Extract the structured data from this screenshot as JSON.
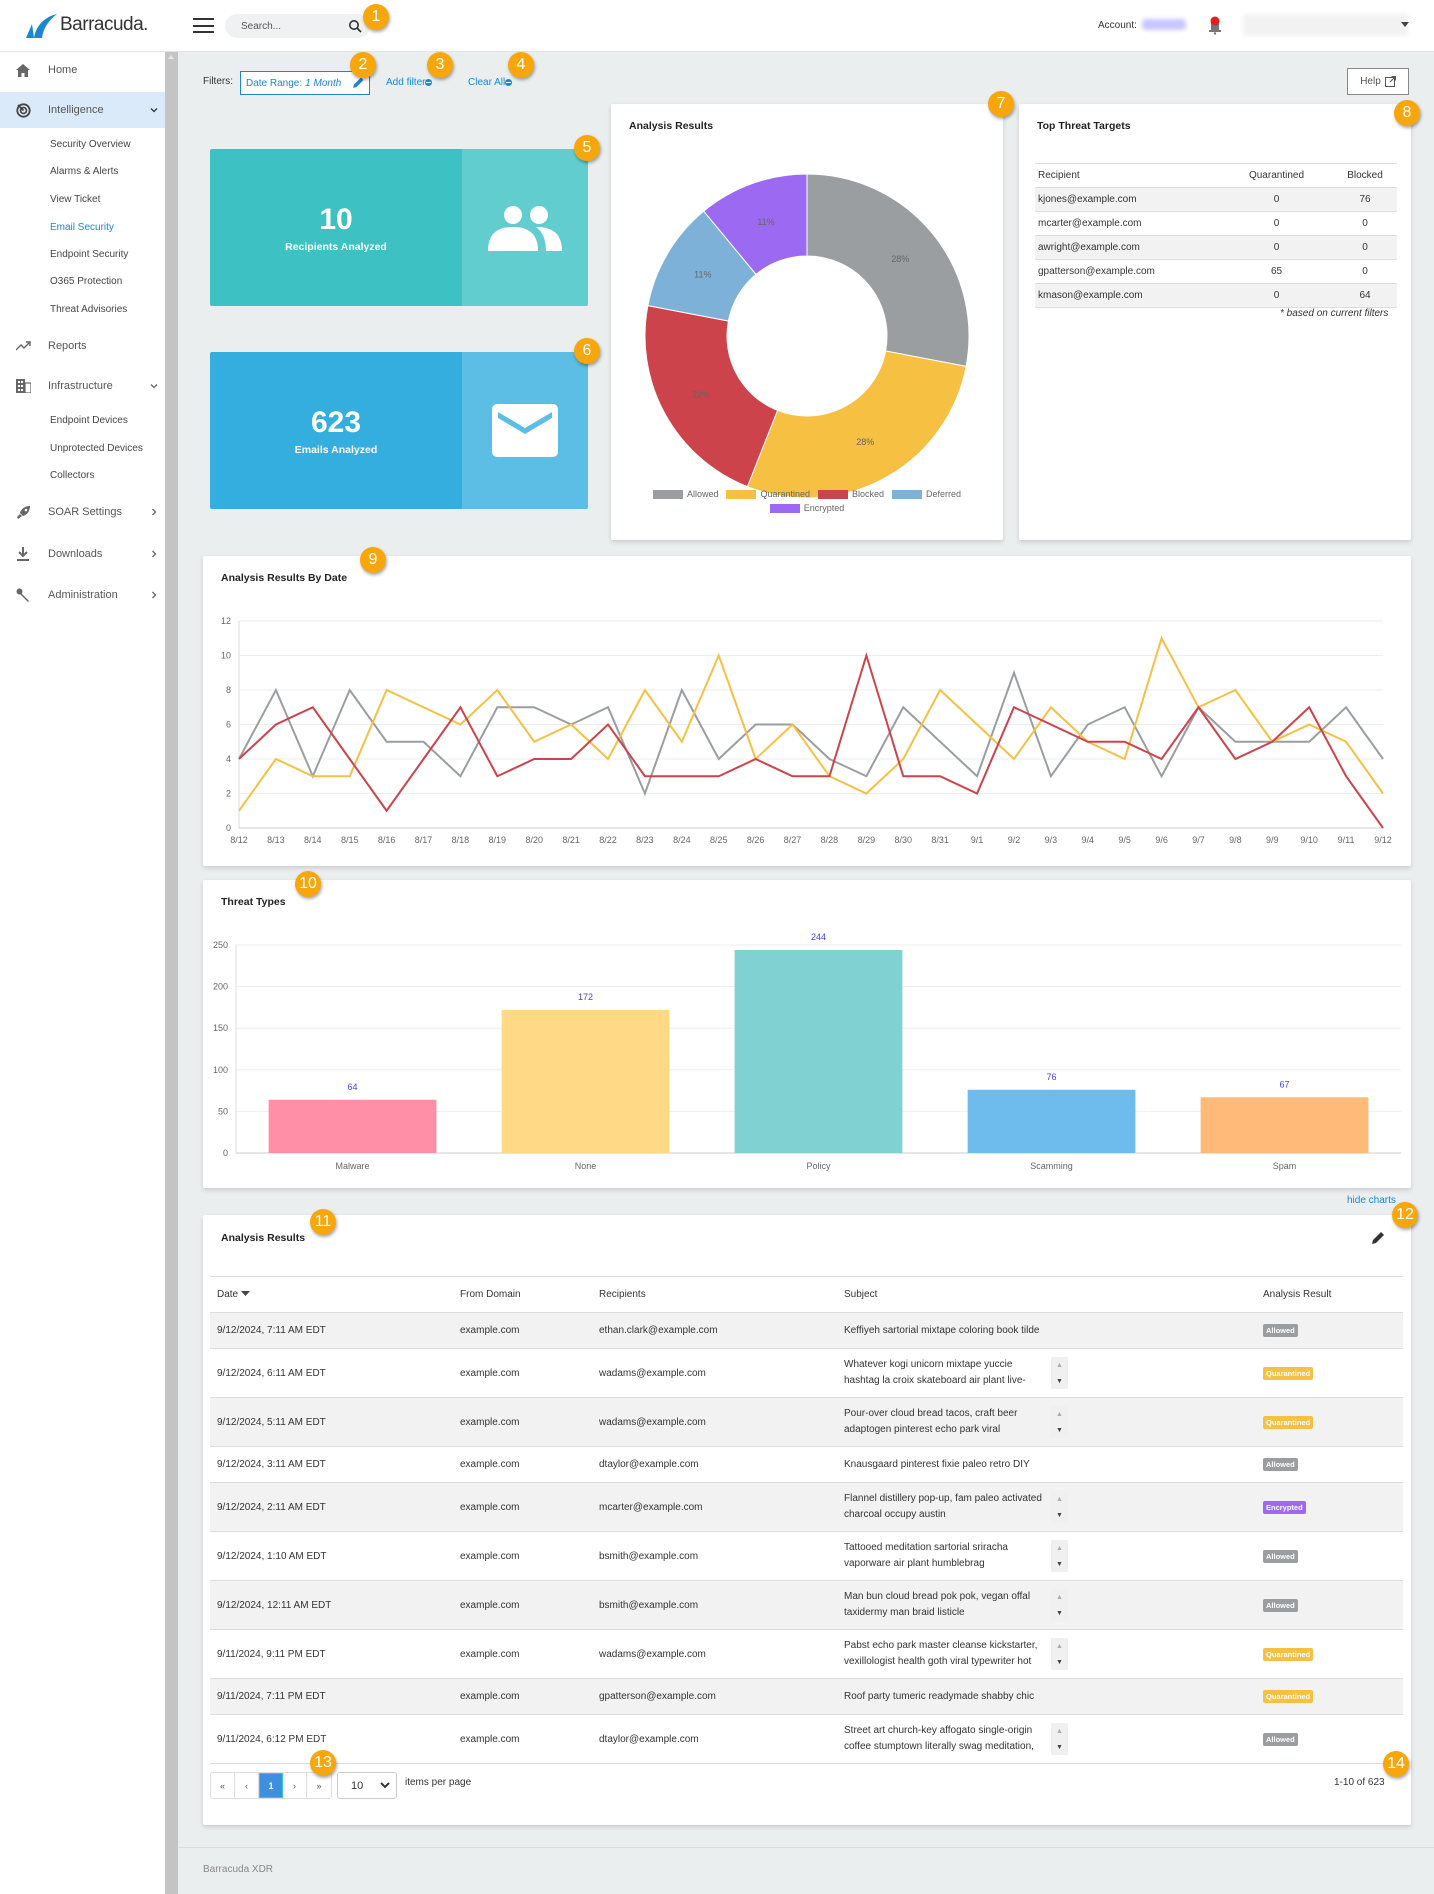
{
  "header": {
    "brand": "Barracuda.",
    "search_placeholder": "Search...",
    "account_label": "Account:"
  },
  "sidebar": {
    "items": [
      {
        "label": "Home",
        "icon": "home-icon"
      },
      {
        "label": "Intelligence",
        "icon": "radar-icon",
        "expanded": true
      },
      {
        "label": "Reports",
        "icon": "trend-icon"
      },
      {
        "label": "Infrastructure",
        "icon": "building-icon",
        "expanded": true
      },
      {
        "label": "SOAR Settings",
        "icon": "rocket-icon"
      },
      {
        "label": "Downloads",
        "icon": "download-icon"
      },
      {
        "label": "Administration",
        "icon": "wrench-icon"
      }
    ],
    "intelligence_sub": [
      "Security Overview",
      "Alarms & Alerts",
      "View Ticket",
      "Email Security",
      "Endpoint Security",
      "O365 Protection",
      "Threat Advisories"
    ],
    "infrastructure_sub": [
      "Endpoint Devices",
      "Unprotected Devices",
      "Collectors"
    ],
    "selected": "Email Security"
  },
  "filters": {
    "label": "Filters:",
    "date_range_label": "Date Range:",
    "date_range_value": "1 Month",
    "add_filter": "Add filter",
    "clear_all": "Clear All",
    "help": "Help"
  },
  "stats": {
    "recipients": {
      "value": "10",
      "label": "Recipients Analyzed"
    },
    "emails": {
      "value": "623",
      "label": "Emails Analyzed"
    }
  },
  "badges": [
    "1",
    "2",
    "3",
    "4",
    "5",
    "6",
    "7",
    "8",
    "9",
    "10",
    "11",
    "12",
    "13",
    "14"
  ],
  "top_threats": {
    "title": "Top Threat Targets",
    "columns": [
      "Recipient",
      "Quarantined",
      "Blocked"
    ],
    "rows": [
      [
        "kjones@example.com",
        "0",
        "76"
      ],
      [
        "mcarter@example.com",
        "0",
        "0"
      ],
      [
        "awright@example.com",
        "0",
        "0"
      ],
      [
        "gpatterson@example.com",
        "65",
        "0"
      ],
      [
        "kmason@example.com",
        "0",
        "64"
      ]
    ],
    "note": "* based on current filters"
  },
  "chart_data": [
    {
      "type": "pie",
      "variant": "doughnut",
      "title": "Analysis Results",
      "categories": [
        "Allowed",
        "Quarantined",
        "Blocked",
        "Deferred",
        "Encrypted"
      ],
      "values": [
        28,
        28,
        22,
        11,
        11
      ],
      "unit": "%",
      "colors": [
        "#9a9ea1",
        "#f6c042",
        "#cd434b",
        "#7db1d7",
        "#9c6af2"
      ],
      "legend": "bottom"
    },
    {
      "type": "line",
      "title": "Analysis Results By Date",
      "x": [
        "8/12",
        "8/13",
        "8/14",
        "8/15",
        "8/16",
        "8/17",
        "8/18",
        "8/19",
        "8/20",
        "8/21",
        "8/22",
        "8/23",
        "8/24",
        "8/25",
        "8/26",
        "8/27",
        "8/28",
        "8/29",
        "8/30",
        "8/31",
        "9/1",
        "9/2",
        "9/3",
        "9/4",
        "9/5",
        "9/6",
        "9/7",
        "9/8",
        "9/9",
        "9/10",
        "9/11",
        "9/12"
      ],
      "ylim": [
        0,
        12
      ],
      "yticks": [
        0,
        2,
        4,
        6,
        8,
        10,
        12
      ],
      "grid": true,
      "series": [
        {
          "name": "Allowed",
          "color": "#9a9ea1",
          "values": [
            4,
            8,
            3,
            8,
            5,
            5,
            3,
            7,
            7,
            6,
            7,
            2,
            8,
            4,
            6,
            6,
            4,
            3,
            7,
            5,
            3,
            9,
            3,
            6,
            7,
            3,
            7,
            5,
            5,
            5,
            7,
            4
          ]
        },
        {
          "name": "Quarantined",
          "color": "#f6c042",
          "values": [
            1,
            4,
            3,
            3,
            8,
            7,
            6,
            8,
            5,
            6,
            4,
            8,
            5,
            10,
            4,
            6,
            3,
            2,
            4,
            8,
            6,
            4,
            7,
            5,
            4,
            11,
            7,
            8,
            5,
            6,
            5,
            2
          ]
        },
        {
          "name": "Blocked",
          "color": "#cd434b",
          "values": [
            4,
            6,
            7,
            4,
            1,
            4,
            7,
            3,
            4,
            4,
            6,
            3,
            3,
            3,
            4,
            3,
            3,
            10,
            3,
            3,
            2,
            7,
            6,
            5,
            5,
            4,
            7,
            4,
            5,
            7,
            3,
            0
          ]
        }
      ]
    },
    {
      "type": "bar",
      "title": "Threat Types",
      "categories": [
        "Malware",
        "None",
        "Policy",
        "Scamming",
        "Spam"
      ],
      "values": [
        64,
        172,
        244,
        76,
        67
      ],
      "data_labels": [
        "64",
        "172",
        "244",
        "76",
        "67"
      ],
      "colors": [
        "#ff8fa6",
        "#ffd986",
        "#80d1d1",
        "#6ebbed",
        "#ffb978"
      ],
      "ylim": [
        0,
        250
      ],
      "yticks": [
        0,
        50,
        100,
        150,
        200,
        250
      ],
      "grid": true
    }
  ],
  "hide_charts": "hide charts",
  "results": {
    "title": "Analysis Results",
    "columns": [
      "Date",
      "From Domain",
      "Recipients",
      "Subject",
      "Analysis Result"
    ],
    "rows": [
      {
        "date": "9/12/2024, 7:11 AM EDT",
        "domain": "example.com",
        "recipient": "ethan.clark@example.com",
        "subject": "Keffiyeh sartorial mixtape coloring book tilde",
        "result": "Allowed",
        "scroll": false
      },
      {
        "date": "9/12/2024, 6:11 AM EDT",
        "domain": "example.com",
        "recipient": "wadams@example.com",
        "subject": "Whatever kogi unicorn mixtape yuccie hashtag la croix skateboard air plant live-",
        "result": "Quarantined",
        "scroll": true
      },
      {
        "date": "9/12/2024, 5:11 AM EDT",
        "domain": "example.com",
        "recipient": "wadams@example.com",
        "subject": "Pour-over cloud bread tacos, craft beer adaptogen pinterest echo park viral",
        "result": "Quarantined",
        "scroll": true
      },
      {
        "date": "9/12/2024, 3:11 AM EDT",
        "domain": "example.com",
        "recipient": "dtaylor@example.com",
        "subject": "Knausgaard pinterest fixie paleo retro DIY",
        "result": "Allowed",
        "scroll": false
      },
      {
        "date": "9/12/2024, 2:11 AM EDT",
        "domain": "example.com",
        "recipient": "mcarter@example.com",
        "subject": "Flannel distillery pop-up, fam paleo activated charcoal occupy austin",
        "result": "Encrypted",
        "scroll": true
      },
      {
        "date": "9/12/2024, 1:10 AM EDT",
        "domain": "example.com",
        "recipient": "bsmith@example.com",
        "subject": "Tattooed meditation sartorial sriracha vaporware air plant humblebrag",
        "result": "Allowed",
        "scroll": true
      },
      {
        "date": "9/12/2024, 12:11 AM EDT",
        "domain": "example.com",
        "recipient": "bsmith@example.com",
        "subject": "Man bun cloud bread pok pok, vegan offal taxidermy man braid listicle",
        "result": "Allowed",
        "scroll": true
      },
      {
        "date": "9/11/2024, 9:11 PM EDT",
        "domain": "example.com",
        "recipient": "wadams@example.com",
        "subject": "Pabst echo park master cleanse kickstarter, vexillologist health goth viral typewriter hot",
        "result": "Quarantined",
        "scroll": true
      },
      {
        "date": "9/11/2024, 7:11 PM EDT",
        "domain": "example.com",
        "recipient": "gpatterson@example.com",
        "subject": "Roof party tumeric readymade shabby chic",
        "result": "Quarantined",
        "scroll": false
      },
      {
        "date": "9/11/2024, 6:12 PM EDT",
        "domain": "example.com",
        "recipient": "dtaylor@example.com",
        "subject": "Street art church-key affogato single-origin coffee stumptown literally swag meditation,",
        "result": "Allowed",
        "scroll": true
      }
    ],
    "result_colors": {
      "Allowed": "#9a9ea1",
      "Quarantined": "#f6c042",
      "Encrypted": "#9c6af2"
    }
  },
  "pagination": {
    "first": "«",
    "prev": "‹",
    "current": "1",
    "next": "›",
    "last": "»",
    "per_page": "10",
    "per_page_label": "items per page",
    "range": "1-10 of 623"
  },
  "footer": "Barracuda XDR"
}
